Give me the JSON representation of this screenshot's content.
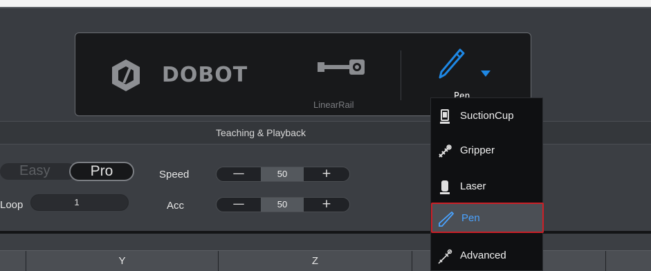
{
  "toolbar": {
    "brand_text": "DOBOT",
    "linear_rail_label": "LinearRail",
    "current_tool_label": "Pen"
  },
  "section": {
    "title": "Teaching & Playback"
  },
  "mode": {
    "easy_label": "Easy",
    "pro_label": "Pro",
    "selected": "Pro"
  },
  "loop": {
    "label": "Loop",
    "value": "1"
  },
  "speed": {
    "label": "Speed",
    "value": "50",
    "minus": "—",
    "plus": "+"
  },
  "acc": {
    "label": "Acc",
    "value": "50",
    "minus": "—",
    "plus": "+"
  },
  "table": {
    "columns": [
      "",
      "Y",
      "Z",
      "",
      ""
    ]
  },
  "tool_menu": {
    "items": [
      {
        "label": "SuctionCup",
        "icon": "suction-cup-icon"
      },
      {
        "label": "Gripper",
        "icon": "gripper-icon"
      },
      {
        "label": "Laser",
        "icon": "laser-icon"
      },
      {
        "label": "Pen",
        "icon": "pen-icon"
      },
      {
        "label": "Advanced",
        "icon": "advanced-icon"
      }
    ],
    "selected_index": 3
  },
  "colors": {
    "accent_blue": "#1e88e5",
    "selection_red": "#cc1f27"
  }
}
